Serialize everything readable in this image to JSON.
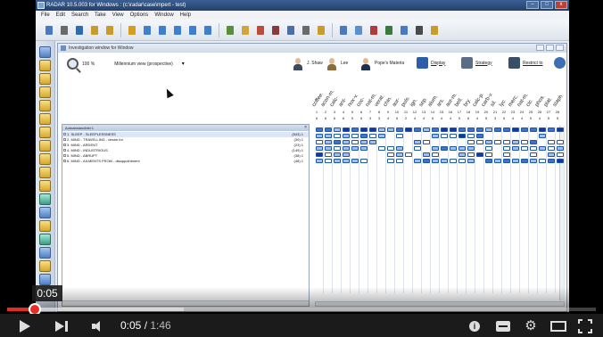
{
  "app": {
    "title": "RADAR 10.5.003 for Windows : (c:\\radar\\case\\mpert - test)",
    "menu": [
      "File",
      "Edit",
      "Search",
      "Take",
      "View",
      "Options",
      "Window",
      "Help"
    ]
  },
  "inner_window": {
    "title": "Investigation window for Window",
    "zoom": "100 %",
    "view_label": "Millennium view (prospective)"
  },
  "personas": [
    {
      "label": "J. Shaw",
      "color": "#3d4a5e"
    },
    {
      "label": "Lee",
      "color": "#8a6b3f"
    },
    {
      "label": "Pope's Materia",
      "color": "#1f2f4f"
    }
  ],
  "tools": [
    {
      "label": "Display",
      "color": "#2c5fa8"
    },
    {
      "label": "Strategy",
      "color": "#5b6e86"
    },
    {
      "label": "Restrict to",
      "color": "#3a4f66"
    }
  ],
  "rubric_panel": {
    "header": "Autoabstandbild 1",
    "rows": [
      {
        "text": "1. SLEEP - SLEEPLESSNESS",
        "count": "(543) 1"
      },
      {
        "text": "2. MIND - TRAVELLING - desire for",
        "count": "(30) 1"
      },
      {
        "text": "3. MIND - ARDENT",
        "count": "(23) 1"
      },
      {
        "text": "4. MIND - INDUSTRIOUS",
        "count": "(149) 1"
      },
      {
        "text": "5. MIND - ABRUPT",
        "count": "(38) 1"
      },
      {
        "text": "6. MIND - AILMENTS FROM - disappointment",
        "count": "(48) 1"
      }
    ]
  },
  "remedies": [
    "coffee.",
    "acon-m.",
    "calc-",
    "ant-",
    "nux-v.",
    "coc-",
    "nat-m.",
    "verat.",
    "chin.",
    "aur-",
    "puls.",
    "ign.",
    "sep.",
    "alum.",
    "ars.",
    "aur-m.",
    "bell.",
    "bry.",
    "calc-p.",
    "carb-v.",
    "sil.",
    "lyc.",
    "merc.",
    "nat-m.",
    "cic.",
    "phos.",
    "plat.",
    "staph."
  ],
  "grid_rows": [
    [
      3,
      3,
      2,
      4,
      3,
      4,
      4,
      2,
      2,
      3,
      4,
      3,
      2,
      3,
      4,
      4,
      3,
      3,
      3,
      2,
      3,
      3,
      4,
      3,
      3,
      4,
      3,
      4
    ],
    [
      2,
      2,
      1,
      2,
      1,
      3,
      1,
      2,
      0,
      1,
      0,
      0,
      0,
      2,
      1,
      1,
      4,
      1,
      3,
      0,
      0,
      0,
      0,
      0,
      0,
      2,
      0,
      0
    ],
    [
      1,
      2,
      3,
      2,
      1,
      2,
      2,
      0,
      0,
      0,
      0,
      2,
      1,
      0,
      0,
      0,
      0,
      1,
      1,
      2,
      1,
      1,
      2,
      1,
      3,
      0,
      1,
      1
    ],
    [
      2,
      2,
      1,
      2,
      2,
      2,
      0,
      1,
      1,
      2,
      0,
      1,
      0,
      2,
      3,
      2,
      2,
      2,
      0,
      1,
      0,
      1,
      2,
      1,
      1,
      2,
      1,
      2
    ],
    [
      4,
      1,
      2,
      2,
      0,
      0,
      0,
      0,
      1,
      2,
      1,
      0,
      2,
      1,
      0,
      0,
      2,
      1,
      4,
      1,
      0,
      1,
      0,
      0,
      1,
      0,
      2,
      1
    ],
    [
      2,
      1,
      2,
      2,
      2,
      1,
      0,
      0,
      1,
      1,
      0,
      2,
      3,
      2,
      2,
      1,
      1,
      2,
      0,
      3,
      2,
      3,
      2,
      3,
      2,
      1,
      3,
      4
    ]
  ],
  "player": {
    "tooltip": "0:05",
    "current": "0:05",
    "duration": "1:46",
    "progress": 0.047,
    "buffered": 0.3,
    "accent": "#e52d27"
  }
}
